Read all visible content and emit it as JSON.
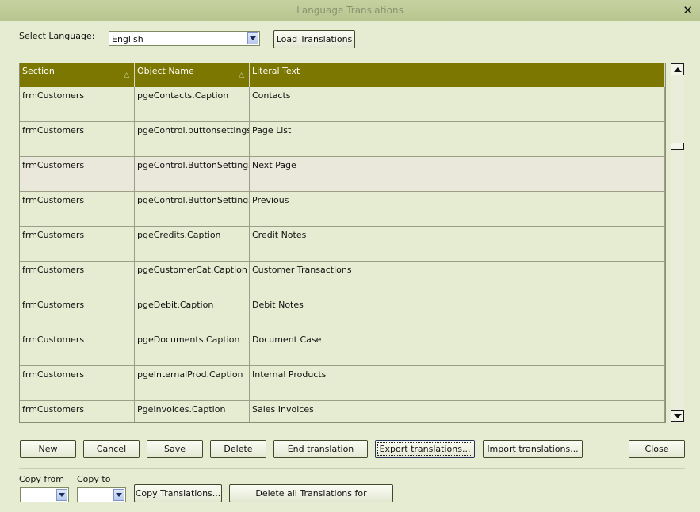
{
  "window": {
    "title": "Language Translations",
    "close_glyph": "✕"
  },
  "language": {
    "label": "Select Language:",
    "selected": "English"
  },
  "load_button": "Load Translations",
  "grid": {
    "columns": [
      "Section",
      "Object Name",
      "Literal Text"
    ],
    "sort_glyph": "△",
    "rows": [
      [
        "frmCustomers",
        "pgeContacts.Caption",
        "Contacts"
      ],
      [
        "frmCustomers",
        "pgeControl.buttonsettings.Pag",
        "Page List"
      ],
      [
        "frmCustomers",
        "pgeControl.ButtonSettings.Sc",
        "Next Page"
      ],
      [
        "frmCustomers",
        "pgeControl.ButtonSettings.Sc",
        "Previous"
      ],
      [
        "frmCustomers",
        "pgeCredits.Caption",
        "Credit Notes"
      ],
      [
        "frmCustomers",
        "pgeCustomerCat.Caption",
        "Customer Transactions"
      ],
      [
        "frmCustomers",
        "pgeDebit.Caption",
        "Debit Notes"
      ],
      [
        "frmCustomers",
        "pgeDocuments.Caption",
        "Document Case"
      ],
      [
        "frmCustomers",
        "pgeInternalProd.Caption",
        "Internal Products"
      ],
      [
        "frmCustomers",
        "PgeInvoices.Caption",
        "Sales Invoices"
      ]
    ],
    "selected_row": 2
  },
  "buttons": {
    "new_first": "N",
    "new_rest": "ew",
    "cancel": "Cancel",
    "save_first": "S",
    "save_rest": "ave",
    "delete_first": "D",
    "delete_rest": "elete",
    "end_translation": "End translation",
    "export_first": "E",
    "export_rest": "xport translations...",
    "import": "Import translations...",
    "close_first": "C",
    "close_rest": "lose"
  },
  "copy": {
    "from_label": "Copy from",
    "to_label": "Copy to",
    "from_value": "",
    "to_value": "",
    "copy_button": "Copy Translations...",
    "delete_all_button": "Delete all Translations for"
  },
  "colors": {
    "header_bg": "#7b7700",
    "background": "#e6ecd1",
    "title_bar": "#c0cb98"
  }
}
